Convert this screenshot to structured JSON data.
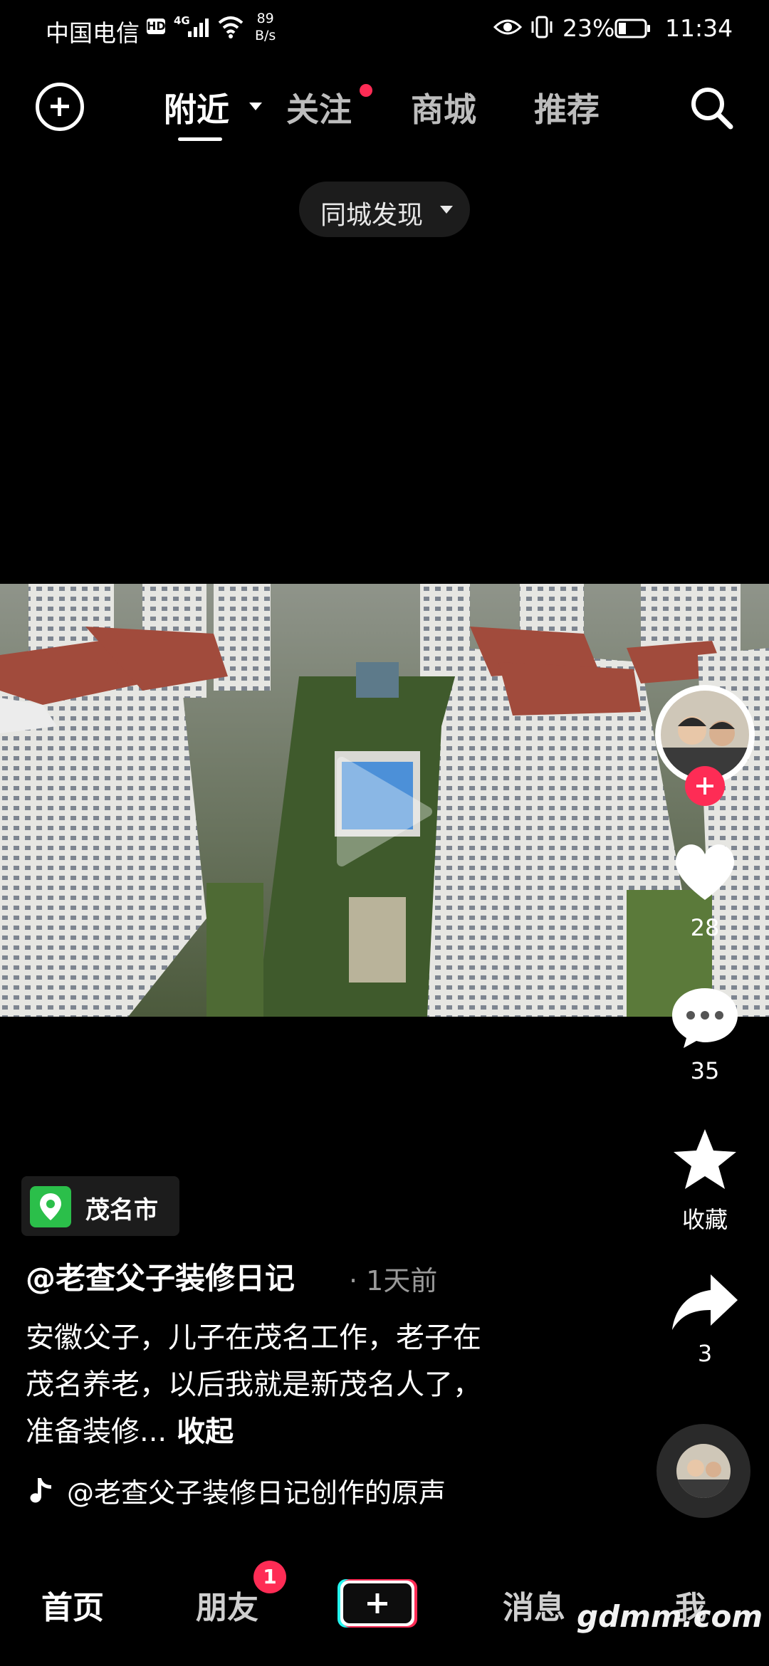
{
  "status_bar": {
    "carrier": "中国电信",
    "hd_badge": "HD",
    "network": "4G",
    "speed_value": "89",
    "speed_unit": "B/s",
    "battery_pct": "23%",
    "time": "11:34"
  },
  "top_nav": {
    "tabs": [
      {
        "label": "附近",
        "active": true
      },
      {
        "label": "关注",
        "active": false,
        "has_dot": true
      },
      {
        "label": "商城",
        "active": false
      },
      {
        "label": "推荐",
        "active": false
      }
    ],
    "city_filter": "同城发现"
  },
  "side_actions": {
    "likes": "28",
    "comments": "35",
    "favorite_label": "收藏",
    "shares": "3"
  },
  "post": {
    "location": "茂名市",
    "author": "@老查父子装修日记",
    "time_ago": "· 1天前",
    "description_lines": [
      "安徽父子，儿子在茂名工作，老子在",
      "茂名养老，以后我就是新茂名人了，",
      "准备装修..."
    ],
    "collapse_label": "收起",
    "sound": "@老查父子装修日记创作的原声"
  },
  "bottom_nav": {
    "home": "首页",
    "friends": "朋友",
    "friends_badge": "1",
    "messages": "消息",
    "me": "我"
  },
  "watermark": "gdmm.com",
  "colors": {
    "accent_red": "#fe2c55",
    "location_green": "#2bbf4a",
    "background": "#000000"
  }
}
